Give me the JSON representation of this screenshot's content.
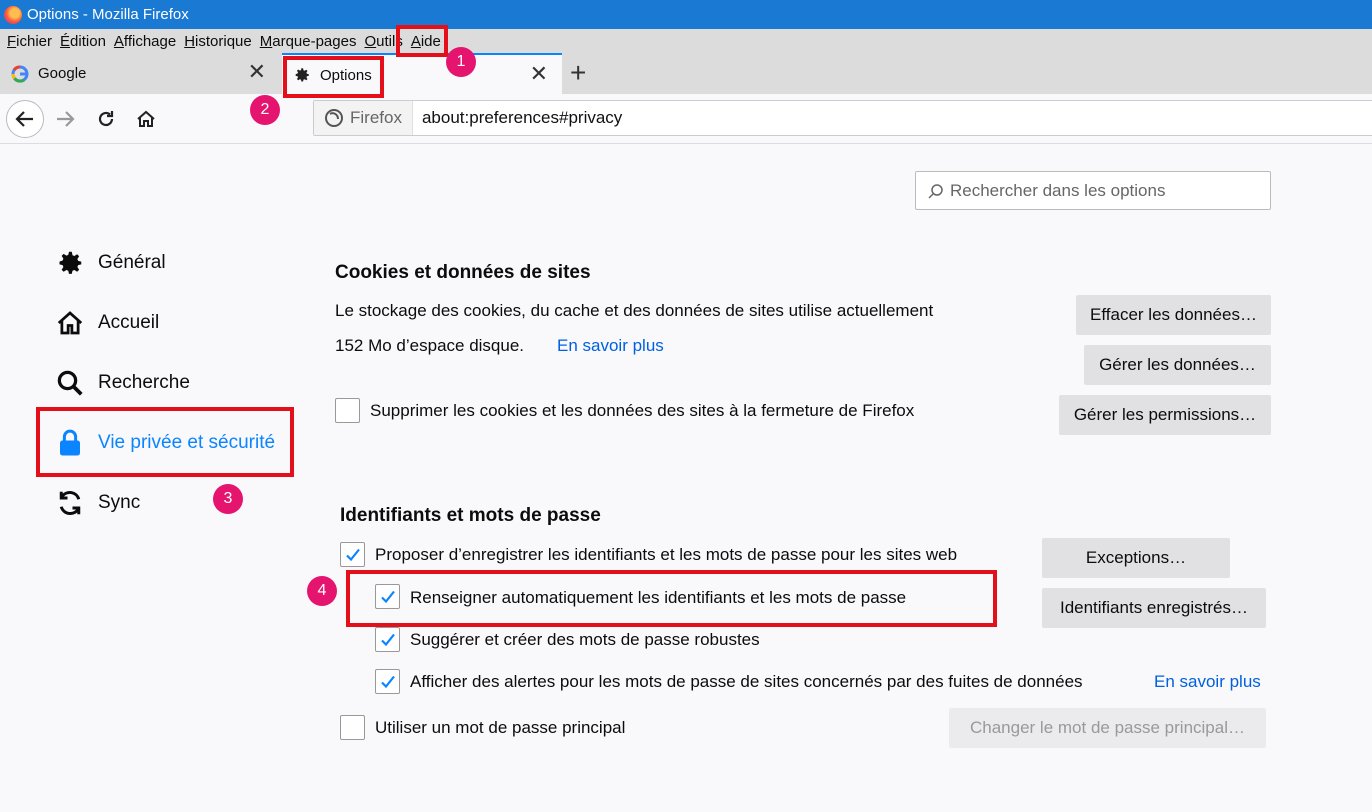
{
  "window": {
    "title": "Options - Mozilla Firefox"
  },
  "menu": [
    "Fichier",
    "Édition",
    "Affichage",
    "Historique",
    "Marque-pages",
    "Outils",
    "Aide"
  ],
  "tabs": [
    {
      "label": "Google",
      "icon": "google-icon"
    },
    {
      "label": "Options",
      "icon": "gear-icon"
    }
  ],
  "urlbar": {
    "identity": "Firefox",
    "url": "about:preferences#privacy"
  },
  "search": {
    "placeholder": "Rechercher dans les options"
  },
  "sidebar": {
    "items": [
      {
        "label": "Général",
        "icon": "gear-icon"
      },
      {
        "label": "Accueil",
        "icon": "home-icon"
      },
      {
        "label": "Recherche",
        "icon": "search-icon"
      },
      {
        "label": "Vie privée et sécurité",
        "icon": "lock-icon",
        "active": true
      },
      {
        "label": "Sync",
        "icon": "sync-icon"
      }
    ]
  },
  "cookies": {
    "heading": "Cookies et données de sites",
    "desc1": "Le stockage des cookies, du cache et des données de sites utilise actuellement",
    "desc2": "152 Mo d’espace disque.",
    "learn_more": "En savoir plus",
    "clear_button": "Effacer les données…",
    "manage_button": "Gérer les données…",
    "permissions_button": "Gérer les permissions…",
    "delete_on_close": {
      "label": "Supprimer les cookies et les données des sites à la fermeture de Firefox",
      "checked": false
    }
  },
  "logins": {
    "heading": "Identifiants et mots de passe",
    "ask_save": {
      "label": "Proposer d’enregistrer les identifiants et les mots de passe pour les sites web",
      "checked": true
    },
    "autofill": {
      "label": "Renseigner automatiquement les identifiants et les mots de passe",
      "checked": true
    },
    "suggest": {
      "label": "Suggérer et créer des mots de passe robustes",
      "checked": true
    },
    "breach_alerts": {
      "label": "Afficher des alertes pour les mots de passe de sites concernés par des fuites de données",
      "checked": true
    },
    "breach_learn_more": "En savoir plus",
    "primary_password": {
      "label": "Utiliser un mot de passe principal",
      "checked": false
    },
    "exceptions_button": "Exceptions…",
    "saved_logins_button": "Identifiants enregistrés…",
    "change_primary_button": "Changer le mot de passe principal…"
  },
  "annotations": {
    "badges": [
      "1",
      "2",
      "3",
      "4"
    ],
    "highlight_color": "#e3101b",
    "badge_color": "#e5146f"
  },
  "colors": {
    "accent": "#0a84ff",
    "link": "#0060df",
    "titlebar": "#1a79d3"
  }
}
